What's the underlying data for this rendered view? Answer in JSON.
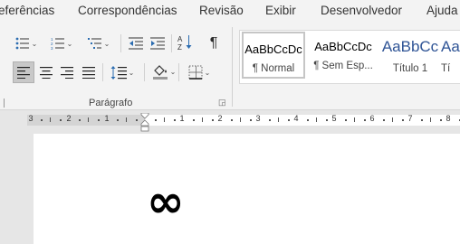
{
  "tabs": [
    {
      "label": "eferências"
    },
    {
      "label": "Correspondências"
    },
    {
      "label": "Revisão"
    },
    {
      "label": "Exibir"
    },
    {
      "label": "Desenvolvedor"
    },
    {
      "label": "Ajuda"
    }
  ],
  "paragraph_group": {
    "label": "Parágrafo",
    "pilcrow": "¶",
    "sort_label": "A↓Z",
    "buttons": [
      {
        "name": "bullets",
        "icon": "bullets-icon"
      },
      {
        "name": "numbering",
        "icon": "numbering-icon"
      },
      {
        "name": "multilevel-list",
        "icon": "multilevel-list-icon"
      },
      {
        "name": "decrease-indent",
        "icon": "decrease-indent-icon"
      },
      {
        "name": "increase-indent",
        "icon": "increase-indent-icon"
      },
      {
        "name": "sort",
        "icon": "sort-icon"
      },
      {
        "name": "show-hide",
        "icon": "pilcrow-icon"
      },
      {
        "name": "align-left",
        "icon": "align-left-icon",
        "active": true
      },
      {
        "name": "center",
        "icon": "align-center-icon"
      },
      {
        "name": "align-right",
        "icon": "align-right-icon"
      },
      {
        "name": "justify",
        "icon": "justify-icon"
      },
      {
        "name": "line-spacing",
        "icon": "line-spacing-icon"
      },
      {
        "name": "shading",
        "icon": "paint-bucket-icon"
      },
      {
        "name": "borders",
        "icon": "borders-icon"
      }
    ]
  },
  "styles": [
    {
      "sample": "AaBbCcDc",
      "name": "¶ Normal",
      "selected": true
    },
    {
      "sample": "AaBbCcDc",
      "name": "¶ Sem Esp..."
    },
    {
      "sample": "AaBbCc",
      "name": "Título 1"
    },
    {
      "sample": "AaB",
      "name": "Tí"
    }
  ],
  "ruler": {
    "numbers": [
      "3",
      "2",
      "1",
      "1",
      "1",
      "2",
      "3",
      "4",
      "5",
      "6",
      "7",
      "8"
    ]
  },
  "document": {
    "content": "∞"
  },
  "colors": {
    "ribbon_bg": "#f3f3f3",
    "title_style": "#2f5496",
    "active_button": "#c8c8c8",
    "page": "#ffffff"
  }
}
